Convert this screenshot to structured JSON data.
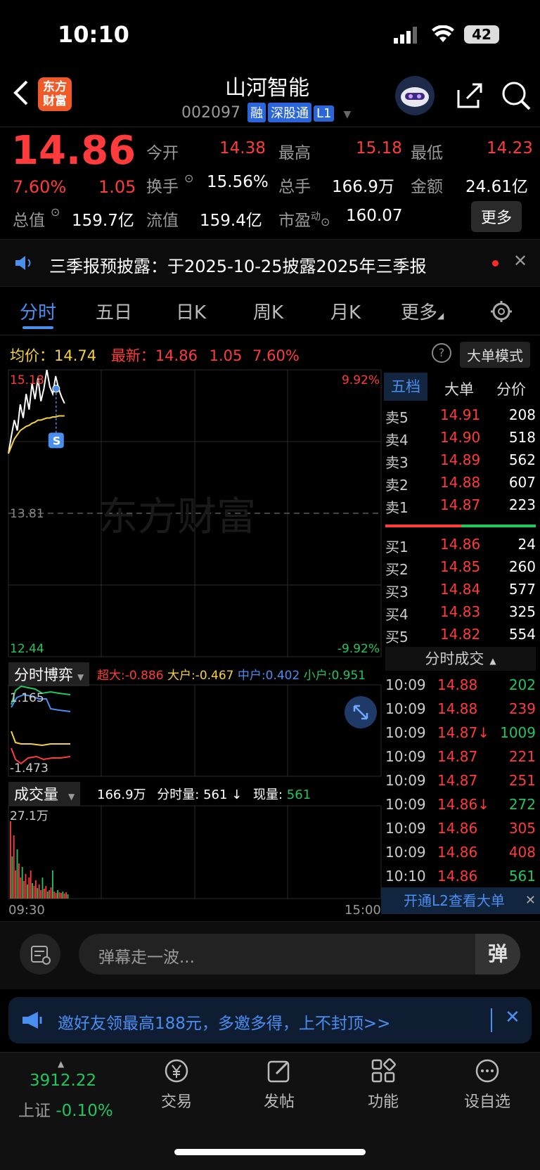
{
  "status_bar": {
    "time": "10:10",
    "battery": "42"
  },
  "header": {
    "logo_text_1": "东方",
    "logo_text_2": "财富",
    "stock_name": "山河智能",
    "stock_code": "002097",
    "tags": [
      "融",
      "深股通",
      "L1"
    ]
  },
  "quote": {
    "price": "14.86",
    "change_pct": "7.60%",
    "change": "1.05",
    "open_label": "今开",
    "open": "14.38",
    "high_label": "最高",
    "high": "15.18",
    "low_label": "最低",
    "low": "14.23",
    "turnover_label": "换手",
    "turnover": "15.56%",
    "volume_label": "总手",
    "volume": "166.9万",
    "amount_label": "金额",
    "amount": "24.61亿",
    "mcap_label": "总值",
    "mcap": "159.7亿",
    "float_label": "流值",
    "float": "159.4亿",
    "pe_label": "市盈",
    "pe_sup": "动",
    "pe": "160.07",
    "more_label": "更多"
  },
  "notice": {
    "text": "三季报预披露：于2025-10-25披露2025年三季报"
  },
  "tabs": [
    {
      "label": "分时"
    },
    {
      "label": "五日"
    },
    {
      "label": "日K"
    },
    {
      "label": "周K"
    },
    {
      "label": "月K"
    },
    {
      "label": "更多"
    }
  ],
  "chart_header": {
    "avg_label": "均价：",
    "avg": "14.74",
    "latest_label": "最新：",
    "latest": "14.86",
    "latest_change": "1.05",
    "latest_pct": "7.60%",
    "mode_label": "大单模式"
  },
  "chart_data": {
    "type": "line",
    "y_max_label": "15.18",
    "y_mid_label": "13.81",
    "y_min_label": "12.44",
    "pct_max_label": "9.92%",
    "pct_min_label": "-9.92%",
    "x_start": "09:30",
    "x_end": "15:00",
    "ylim": [
      12.44,
      15.18
    ],
    "price_series": [
      14.38,
      14.55,
      14.7,
      14.6,
      14.85,
      14.72,
      14.95,
      14.8,
      15.05,
      14.9,
      15.1,
      14.88,
      15.0,
      15.18,
      15.02,
      14.95,
      15.12,
      15.0,
      14.92,
      14.86
    ],
    "avg_series": [
      14.38,
      14.45,
      14.52,
      14.56,
      14.6,
      14.62,
      14.64,
      14.65,
      14.67,
      14.68,
      14.7,
      14.7,
      14.71,
      14.72,
      14.72,
      14.73,
      14.73,
      14.74,
      14.74,
      14.74
    ],
    "marker_label": "S",
    "watermark": "东方财富"
  },
  "order_book": {
    "tabs": [
      "五档",
      "大单",
      "分价"
    ],
    "asks": [
      {
        "label": "卖5",
        "price": "14.91",
        "vol": "208"
      },
      {
        "label": "卖4",
        "price": "14.90",
        "vol": "518"
      },
      {
        "label": "卖3",
        "price": "14.89",
        "vol": "562"
      },
      {
        "label": "卖2",
        "price": "14.88",
        "vol": "607"
      },
      {
        "label": "卖1",
        "price": "14.87",
        "vol": "223"
      }
    ],
    "bids": [
      {
        "label": "买1",
        "price": "14.86",
        "vol": "24"
      },
      {
        "label": "买2",
        "price": "14.85",
        "vol": "260"
      },
      {
        "label": "买3",
        "price": "14.84",
        "vol": "577"
      },
      {
        "label": "买4",
        "price": "14.83",
        "vol": "325"
      },
      {
        "label": "买5",
        "price": "14.82",
        "vol": "554"
      }
    ]
  },
  "trades": {
    "title": "分时成交",
    "rows": [
      {
        "time": "10:09",
        "price": "14.88",
        "vol": "202",
        "dir": "green"
      },
      {
        "time": "10:09",
        "price": "14.88",
        "vol": "239",
        "dir": "red"
      },
      {
        "time": "10:09",
        "price": "14.87↓",
        "vol": "1009",
        "dir": "green"
      },
      {
        "time": "10:09",
        "price": "14.87",
        "vol": "221",
        "dir": "red"
      },
      {
        "time": "10:09",
        "price": "14.87",
        "vol": "251",
        "dir": "red"
      },
      {
        "time": "10:09",
        "price": "14.86↓",
        "vol": "272",
        "dir": "green"
      },
      {
        "time": "10:09",
        "price": "14.86",
        "vol": "305",
        "dir": "red"
      },
      {
        "time": "10:09",
        "price": "14.86",
        "vol": "408",
        "dir": "red"
      },
      {
        "time": "10:10",
        "price": "14.86",
        "vol": "561",
        "dir": "green"
      }
    ],
    "l2_label": "开通L2查看大单"
  },
  "flow": {
    "selector": "分时博弈",
    "super_label": "超大:",
    "super": "-0.886",
    "large_label": "大户:",
    "large": "-0.467",
    "mid_label": "中户:",
    "mid": "0.402",
    "small_label": "小户:",
    "small": "0.951",
    "max_label": "1.165",
    "min_label": "-1.473"
  },
  "volume": {
    "selector": "成交量",
    "total": "166.9万",
    "tick_label": "分时量:",
    "tick": "561 ↓",
    "now_label": "现量:",
    "now": "561",
    "max_label": "27.1万"
  },
  "comment": {
    "placeholder": "弹幕走一波..."
  },
  "banner": {
    "text": "邀好友领最高188元，多邀多得，上不封顶>>"
  },
  "bottom_nav": {
    "index_value": "3912.22",
    "index_name": "上证",
    "index_pct": "-0.10%",
    "items": [
      {
        "label": "交易"
      },
      {
        "label": "发帖"
      },
      {
        "label": "功能"
      },
      {
        "label": "设自选"
      }
    ]
  }
}
